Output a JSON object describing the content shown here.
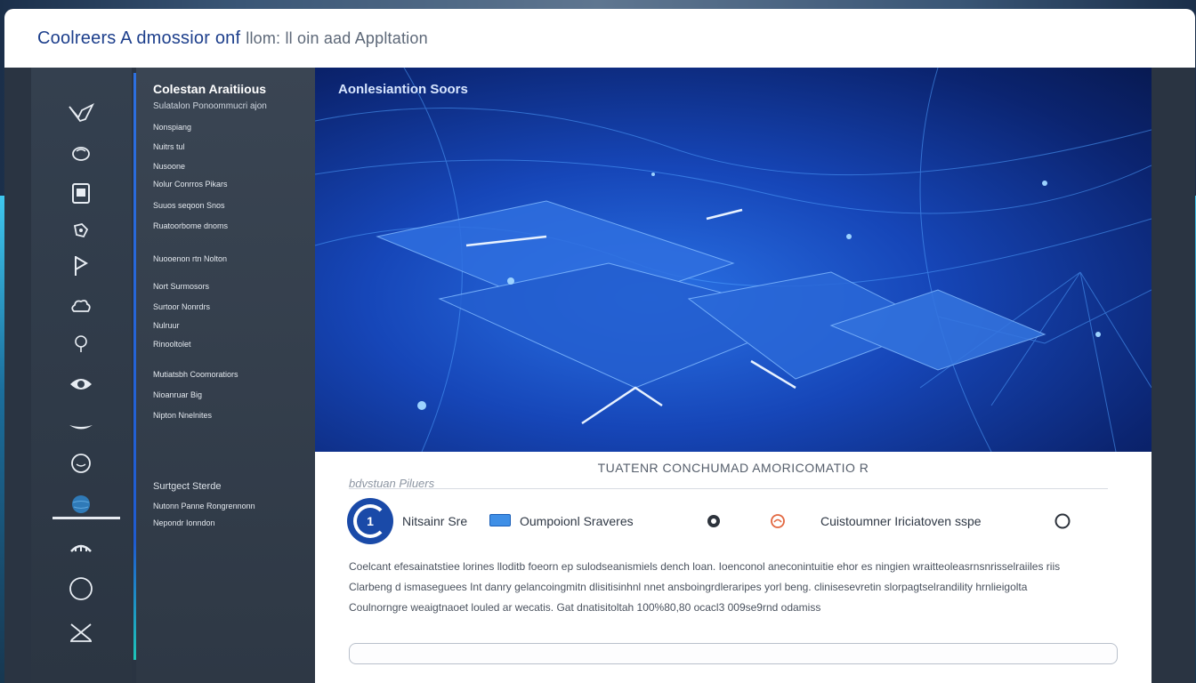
{
  "window": {
    "title": "Coolreers A dmossior onf",
    "title_secondary": "llom: ll oin aad Appltation"
  },
  "rail": {
    "icons": [
      "bird-icon",
      "brain-icon",
      "clipboard-icon",
      "puzzle-icon",
      "flag-icon",
      "cloud-icon",
      "lightbulb-icon",
      "eye-icon",
      "boat-icon",
      "head-icon",
      "globe-icon",
      "group-icon",
      "circle-icon",
      "crossed-tools-icon"
    ],
    "active_index": 11
  },
  "nav": {
    "title": "Colestan Araitiious",
    "subtitle": "Sulatalon Ponoommucri ajon",
    "group1": [
      "Nonspiang",
      "Nuitrs tul",
      "Nusoone",
      "Nolur Conrros Pikars",
      "Suuos seqoon Snos",
      "Ruatoorbome dnoms"
    ],
    "group2": [
      "Nuooenon rtn Nolton"
    ],
    "group3": [
      "Nort Surmosors",
      "Surtoor Nonrdrs",
      "Nulruur",
      "Rinooltolet"
    ],
    "group4": [
      "Mutiatsbh Coomoratiors",
      "Nioanruar Big",
      "Nipton Nnelnites"
    ],
    "section": "Surtgect Sterde",
    "group5": [
      "Nutonn Panne Rongrennonn",
      "Nepondr Ionndon"
    ]
  },
  "hero": {
    "title": "Aonlesiantion Soors"
  },
  "content": {
    "heading": "TUATENR CONCHUMAD AMORICOMATIO R",
    "sublabel": "bdvstuan Piluers",
    "logo_text": "1",
    "feature1": "Nitsainr Sre",
    "feature2": "Oumpoionl Sraveres",
    "feature3": "Cuistoumner Iriciatoven sspe",
    "description": [
      "Coelcant efesainatstiee lorines lloditb foeorn ep sulodseanismiels dench loan. Ioenconol aneconintuitie ehor es ningien wraitteoleasrnsnrisselraiiles riis",
      "Clarbeng d ismaseguees Int danry gelancoingmitn dlisitisinhnl nnet ansboingrdleraripes yorl beng. clinisesevretin slorpagtselrandility hrnlieigolta",
      "Coulnorngre weaigtnaoet louled ar wecatis. Gat dnatisitoltah 100%80,80 ocacl3 009se9rnd odamiss"
    ]
  },
  "colors": {
    "accent": "#1d3f8c",
    "hero_blue": "#1646b8",
    "rail_bg": "#34404f"
  }
}
